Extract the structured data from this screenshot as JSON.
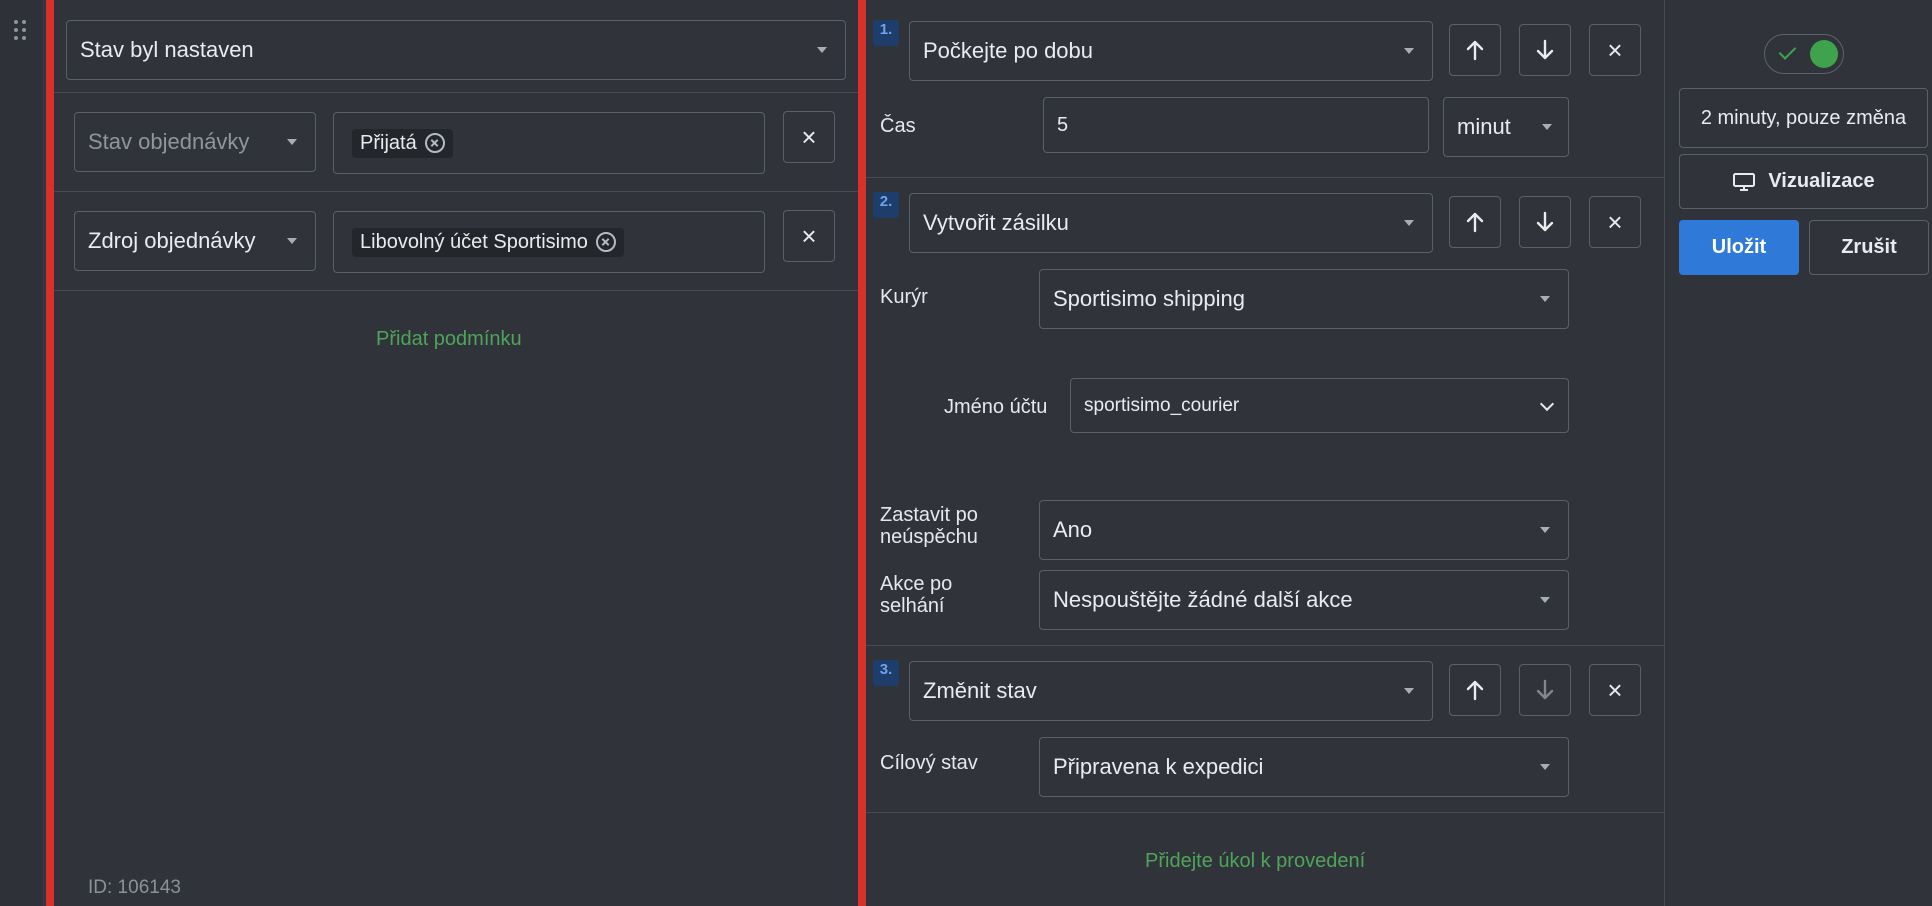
{
  "trigger": {
    "event_value": "Stav byl nastaven",
    "conditions": [
      {
        "field_placeholder": "Stav objednávky",
        "tag": "Přijatá"
      },
      {
        "field_value": "Zdroj objednávky",
        "tag": "Libovolný účet Sportisimo"
      }
    ],
    "add_condition_label": "Přidat podmínku",
    "id_label": "ID: 106143"
  },
  "actions": [
    {
      "number": "1.",
      "type": "Počkejte po dobu",
      "fields": {
        "time_label": "Čas",
        "time_value": "5",
        "unit_value": "minut"
      }
    },
    {
      "number": "2.",
      "type": "Vytvořit zásilku",
      "fields": {
        "courier_label": "Kurýr",
        "courier_value": "Sportisimo shipping",
        "account_label": "Jméno účtu",
        "account_value": "sportisimo_courier",
        "stop_label": "Zastavit po neúspěchu",
        "stop_value": "Ano",
        "fail_label": "Akce po selhání",
        "fail_value": "Nespouštějte žádné další akce"
      }
    },
    {
      "number": "3.",
      "type": "Změnit stav",
      "fields": {
        "target_label": "Cílový stav",
        "target_value": "Připravena k expedici"
      }
    }
  ],
  "add_task_label": "Přidejte úkol k provedení",
  "side": {
    "toggle_on": true,
    "schedule_label": "2 minuty, pouze změna",
    "visualize_label": "Vizualizace",
    "save_label": "Uložit",
    "cancel_label": "Zrušit"
  },
  "colors": {
    "background": "#30343a",
    "accent_red": "#d9302c",
    "link_green": "#4ea45a",
    "primary_blue": "#2f7ad8",
    "badge_blue": "#6da3ee"
  },
  "icons": {
    "drag": "drag-handle-icon",
    "up": "arrow-up-icon",
    "down": "arrow-down-icon",
    "close": "close-icon",
    "monitor": "monitor-icon"
  }
}
